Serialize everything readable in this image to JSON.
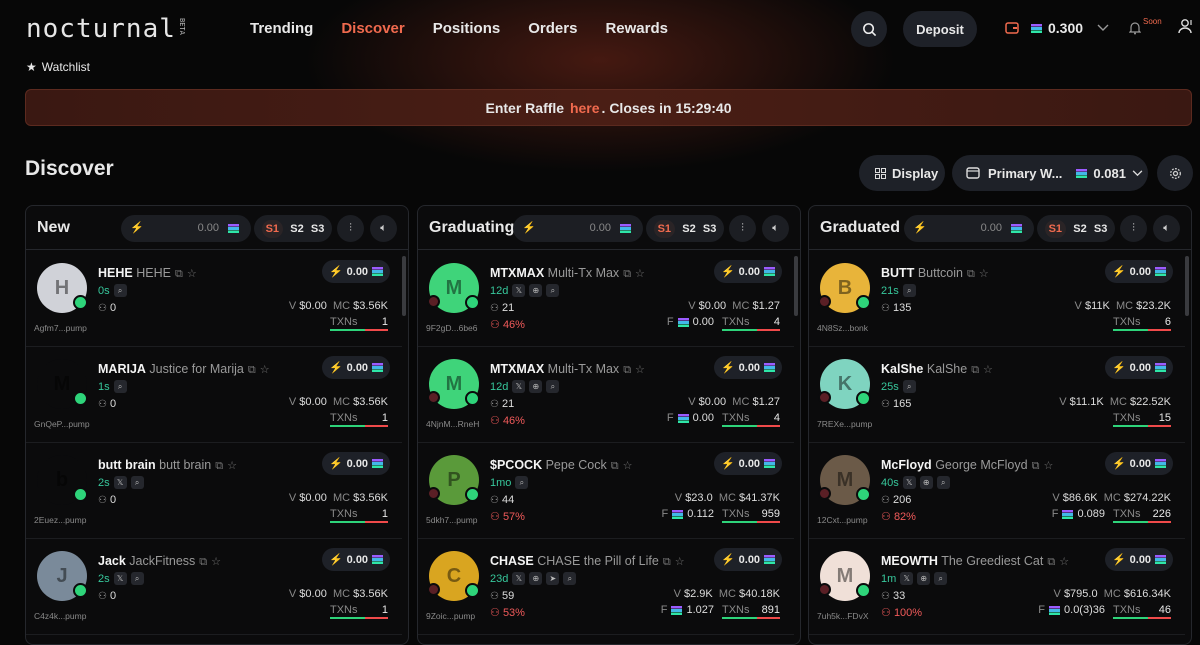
{
  "nav": {
    "logo": "nocturnal",
    "logo_tag": "BETA",
    "links": [
      "Trending",
      "Discover",
      "Positions",
      "Orders",
      "Rewards"
    ],
    "active": "Discover",
    "deposit_label": "Deposit",
    "balance": "0.300",
    "soon_label": "Soon"
  },
  "watchlist_label": "Watchlist",
  "raffle": {
    "before": "Enter Raffle",
    "link": "here",
    "after": ". Closes in 15:29:40"
  },
  "page_title": "Discover",
  "display_label": "Display",
  "wallet_select": {
    "name": "Primary W...",
    "balance": "0.081"
  },
  "accent": "#f06a4e",
  "columns": [
    {
      "title": "New",
      "quick_buy": "0.00",
      "presets": [
        "S1",
        "S2",
        "S3"
      ],
      "cards": [
        {
          "symbol": "HEHE",
          "name": "HEHE",
          "addr": "Agfm7...pump",
          "age": "0s",
          "socials": [
            "search"
          ],
          "holders": "0",
          "vol": "$0.00",
          "mc": "$3.56K",
          "txns": "1",
          "buy": "0.00",
          "avatar_color": "#d0d2d8"
        },
        {
          "symbol": "MARIJA",
          "name": "Justice for Marija",
          "addr": "GnQeP...pump",
          "age": "1s",
          "socials": [
            "search"
          ],
          "holders": "0",
          "vol": "$0.00",
          "mc": "$3.56K",
          "txns": "1",
          "buy": "0.00",
          "avatar_color": "#0b0b0c"
        },
        {
          "symbol": "butt brain",
          "name": "butt brain",
          "addr": "2Euez...pump",
          "age": "2s",
          "socials": [
            "x",
            "search"
          ],
          "holders": "0",
          "vol": "$0.00",
          "mc": "$3.56K",
          "txns": "1",
          "buy": "0.00",
          "avatar_color": "#0b0b0c"
        },
        {
          "symbol": "Jack",
          "name": "JackFitness",
          "addr": "C4z4k...pump",
          "age": "2s",
          "socials": [
            "x",
            "search"
          ],
          "holders": "0",
          "vol": "$0.00",
          "mc": "$3.56K",
          "txns": "1",
          "buy": "0.00",
          "avatar_color": "#7a8a9a"
        }
      ]
    },
    {
      "title": "Graduating",
      "quick_buy": "0.00",
      "presets": [
        "S1",
        "S2",
        "S3"
      ],
      "cards": [
        {
          "symbol": "MTXMAX",
          "name": "Multi-Tx Max",
          "addr": "9F2gD...6be6",
          "age": "12d",
          "socials": [
            "x",
            "web",
            "search"
          ],
          "holders": "21",
          "pct": "46%",
          "vol": "$0.00",
          "mc": "$1.27",
          "fee": "0.00",
          "txns": "4",
          "buy": "0.00",
          "avatar_color": "#3fd47a"
        },
        {
          "symbol": "MTXMAX",
          "name": "Multi-Tx Max",
          "addr": "4NjnM...RneH",
          "age": "12d",
          "socials": [
            "x",
            "web",
            "search"
          ],
          "holders": "21",
          "pct": "46%",
          "vol": "$0.00",
          "mc": "$1.27",
          "fee": "0.00",
          "txns": "4",
          "buy": "0.00",
          "avatar_color": "#3fd47a"
        },
        {
          "symbol": "$PCOCK",
          "name": "Pepe Cock",
          "addr": "5dkh7...pump",
          "age": "1mo",
          "socials": [
            "search"
          ],
          "holders": "44",
          "pct": "57%",
          "vol": "$23.0",
          "mc": "$41.37K",
          "fee": "0.112",
          "txns": "959",
          "buy": "0.00",
          "avatar_color": "#5a9a3a"
        },
        {
          "symbol": "CHASE",
          "name": "CHASE the Pill of Life",
          "addr": "9Zoic...pump",
          "age": "23d",
          "socials": [
            "x",
            "web",
            "tg",
            "search"
          ],
          "holders": "59",
          "pct": "53%",
          "vol": "$2.9K",
          "mc": "$40.18K",
          "fee": "1.027",
          "txns": "891",
          "buy": "0.00",
          "avatar_color": "#d9a520"
        }
      ]
    },
    {
      "title": "Graduated",
      "quick_buy": "0.00",
      "presets": [
        "S1",
        "S2",
        "S3"
      ],
      "cards": [
        {
          "symbol": "BUTT",
          "name": "Buttcoin",
          "addr": "4N8Sz...bonk",
          "age": "21s",
          "socials": [
            "search"
          ],
          "holders": "135",
          "vol": "$11K",
          "mc": "$23.2K",
          "txns": "6",
          "buy": "0.00",
          "avatar_color": "#e8b43a"
        },
        {
          "symbol": "KalShe",
          "name": "KalShe",
          "addr": "7REXe...pump",
          "age": "25s",
          "socials": [
            "search"
          ],
          "holders": "165",
          "vol": "$11.1K",
          "mc": "$22.52K",
          "txns": "15",
          "buy": "0.00",
          "avatar_color": "#7fd4c0"
        },
        {
          "symbol": "McFloyd",
          "name": "George McFloyd",
          "addr": "12Cxt...pump",
          "age": "40s",
          "socials": [
            "x",
            "web",
            "search"
          ],
          "holders": "206",
          "pct": "82%",
          "vol": "$86.6K",
          "mc": "$274.22K",
          "fee": "0.089",
          "txns": "226",
          "buy": "0.00",
          "avatar_color": "#6b5a48"
        },
        {
          "symbol": "MEOWTH",
          "name": "The Greediest Cat",
          "addr": "7uh5k...FDvX",
          "age": "1m",
          "socials": [
            "x",
            "web",
            "search"
          ],
          "holders": "33",
          "pct": "100%",
          "vol": "$795.0",
          "mc": "$616.34K",
          "fee": "0.0(3)36",
          "txns": "46",
          "buy": "0.00",
          "avatar_color": "#f0e0d8"
        }
      ]
    }
  ]
}
